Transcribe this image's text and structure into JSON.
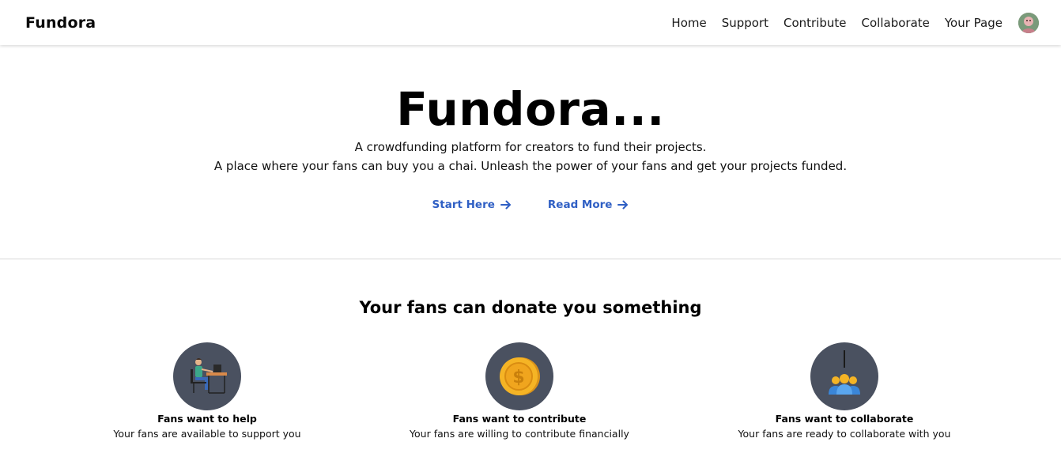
{
  "navbar": {
    "brand": "Fundora",
    "links": [
      "Home",
      "Support",
      "Contribute",
      "Collaborate",
      "Your Page"
    ],
    "avatar_icon": "user-avatar"
  },
  "hero": {
    "title": "Fundora...",
    "line1": "A crowdfunding platform for creators to fund their projects.",
    "line2": "A place where your fans can buy you a chai. Unleash the power of your fans and get your projects funded.",
    "actions": [
      {
        "label": "Start Here",
        "icon": "arrow-right-icon"
      },
      {
        "label": "Read More",
        "icon": "arrow-right-icon"
      }
    ],
    "action_color": "#2f5fc4"
  },
  "section": {
    "title": "Your fans can donate you something",
    "features": [
      {
        "title": "Fans want to help",
        "description": "Your fans are available to support you",
        "icon": "person-at-desk-icon"
      },
      {
        "title": "Fans want to contribute",
        "description": "Your fans are willing to contribute financially",
        "icon": "gold-coin-icon"
      },
      {
        "title": "Fans want to collaborate",
        "description": "Your fans are ready to collaborate with you",
        "icon": "group-meeting-icon"
      }
    ],
    "icon_circle_color": "#4a5160"
  }
}
